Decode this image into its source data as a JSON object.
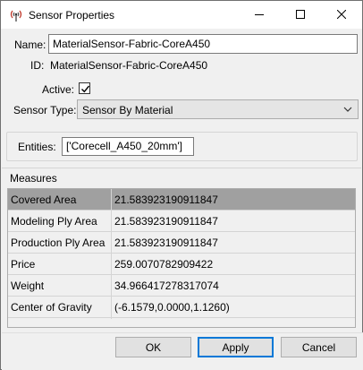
{
  "window": {
    "title": "Sensor Properties",
    "accent_color": "#0078d7"
  },
  "form": {
    "name_label": "Name:",
    "name_value": "MaterialSensor-Fabric-CoreA450",
    "id_label": "ID:",
    "id_value": "MaterialSensor-Fabric-CoreA450",
    "active_label": "Active:",
    "active_checked": true,
    "sensor_type_label": "Sensor Type:",
    "sensor_type_value": "Sensor By Material",
    "entities_label": "Entities:",
    "entities_value": "['Corecell_A450_20mm']"
  },
  "measures": {
    "title": "Measures",
    "selected_row_color": "#a0a0a0",
    "rows": [
      {
        "name": "Covered Area",
        "value": "21.583923190911847",
        "selected": true
      },
      {
        "name": "Modeling Ply Area",
        "value": "21.583923190911847"
      },
      {
        "name": "Production Ply Area",
        "value": "21.583923190911847"
      },
      {
        "name": "Price",
        "value": "259.0070782909422"
      },
      {
        "name": "Weight",
        "value": "34.966417278317074"
      },
      {
        "name": "Center of Gravity",
        "value": "(-6.1579,0.0000,1.1260)"
      }
    ]
  },
  "buttons": {
    "ok": "OK",
    "apply": "Apply",
    "cancel": "Cancel"
  }
}
